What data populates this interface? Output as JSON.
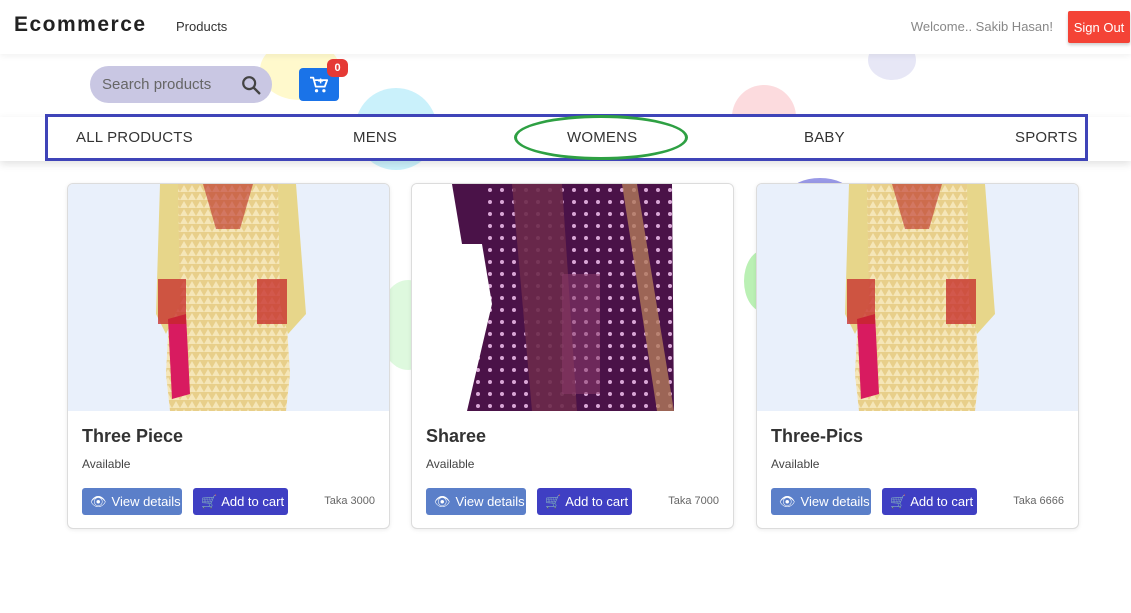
{
  "navbar": {
    "brand": "Ecommerce",
    "products_link": "Products",
    "welcome": "Welcome.. Sakib Hasan!",
    "signout_label": "Sign Out"
  },
  "search": {
    "placeholder": "Search products"
  },
  "cart": {
    "count": "0"
  },
  "categories": [
    "ALL PRODUCTS",
    "MENS",
    "WOMENS",
    "BABY",
    "SPORTS"
  ],
  "products": [
    {
      "title": "Three Piece",
      "status": "Available",
      "view_label": "View details",
      "cart_label": "Add to cart",
      "price": "Taka 3000",
      "image": "three-piece-dress"
    },
    {
      "title": "Sharee",
      "status": "Available",
      "view_label": "View details",
      "cart_label": "Add to cart",
      "price": "Taka 7000",
      "image": "sharee"
    },
    {
      "title": "Three-Pics",
      "status": "Available",
      "view_label": "View details",
      "cart_label": "Add to cart",
      "price": "Taka 6666",
      "image": "three-piece-dress"
    }
  ],
  "colors": {
    "signout": "#f44336",
    "cart_button": "#1a73e8",
    "category_outline": "#3f44b8",
    "womens_highlight": "#2ea043",
    "view_button": "#5b7fc9",
    "add_cart_button": "#3f3fc3"
  }
}
